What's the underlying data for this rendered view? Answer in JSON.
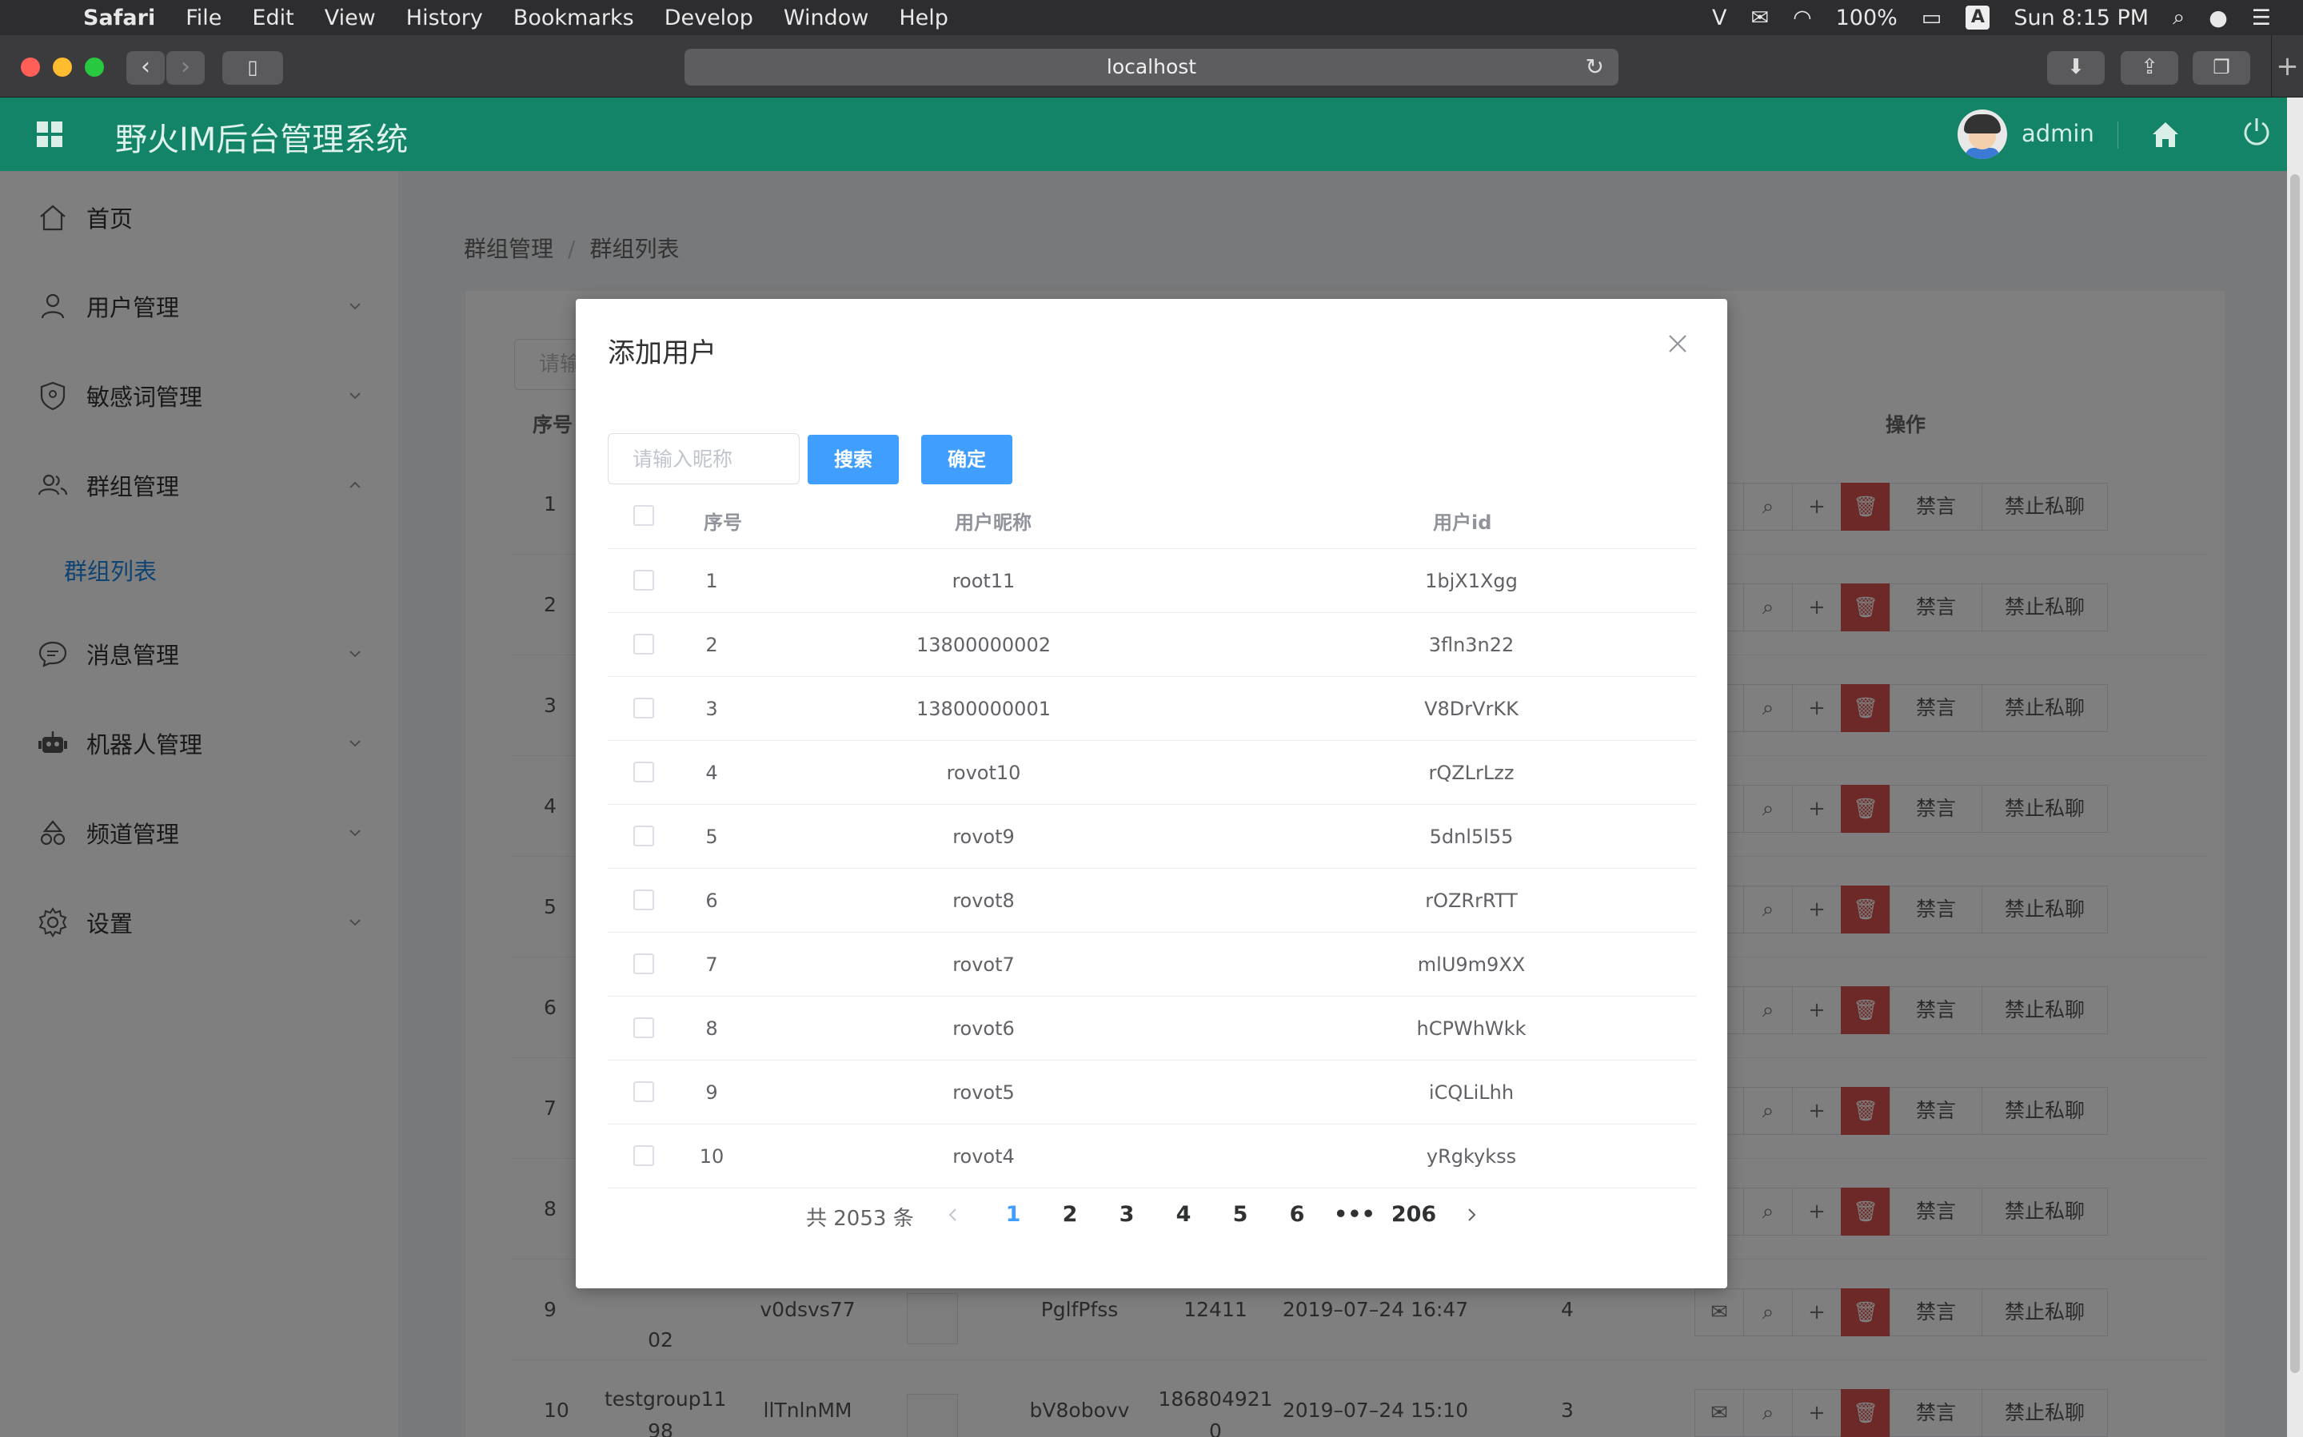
{
  "menubar": {
    "items": [
      "Safari",
      "File",
      "Edit",
      "View",
      "History",
      "Bookmarks",
      "Develop",
      "Window",
      "Help"
    ],
    "battery": "100%",
    "input_source": "A",
    "clock": "Sun 8:15 PM"
  },
  "browser": {
    "url": "localhost"
  },
  "app": {
    "title": "野火IM后台管理系统",
    "user": "admin"
  },
  "sidebar": {
    "items": [
      {
        "label": "首页",
        "icon": "home-icon"
      },
      {
        "label": "用户管理",
        "icon": "user-icon"
      },
      {
        "label": "敏感词管理",
        "icon": "shield-icon"
      },
      {
        "label": "群组管理",
        "icon": "group-icon"
      },
      {
        "label": "消息管理",
        "icon": "message-icon"
      },
      {
        "label": "机器人管理",
        "icon": "robot-icon"
      },
      {
        "label": "频道管理",
        "icon": "channel-icon"
      },
      {
        "label": "设置",
        "icon": "gear-icon"
      }
    ],
    "sub_item": "群组列表"
  },
  "breadcrumb": {
    "parent": "群组管理",
    "sep": "/",
    "current": "群组列表"
  },
  "background_table": {
    "filter_placeholder": "请输",
    "col_index": "序号",
    "col_actions": "操作",
    "btn_mute": "禁言",
    "btn_no_private": "禁止私聊",
    "rows": [
      {
        "idx": "1"
      },
      {
        "idx": "2"
      },
      {
        "idx": "3"
      },
      {
        "idx": "4"
      },
      {
        "idx": "5"
      },
      {
        "idx": "6"
      },
      {
        "idx": "7"
      },
      {
        "idx": "8"
      },
      {
        "idx": "9",
        "name_line2": "02",
        "owner": "v0dsvs77",
        "gid": "PglfPfss",
        "num": "12411",
        "time": "2019–07–24 16:47",
        "count": "4"
      },
      {
        "idx": "10",
        "name_line1": "testgroup11",
        "name_line2": "98",
        "owner": "llTnlnMM",
        "gid": "bV8obovv",
        "num": "186804921",
        "num_line2": "0",
        "time": "2019–07–24 15:10",
        "count": "3"
      }
    ]
  },
  "dialog": {
    "title": "添加用户",
    "search_placeholder": "请输入昵称",
    "search_button": "搜索",
    "confirm_button": "确定",
    "columns": {
      "index": "序号",
      "nickname": "用户昵称",
      "uid": "用户id"
    },
    "rows": [
      {
        "idx": "1",
        "nickname": "root11",
        "uid": "1bjX1Xgg"
      },
      {
        "idx": "2",
        "nickname": "13800000002",
        "uid": "3fln3n22"
      },
      {
        "idx": "3",
        "nickname": "13800000001",
        "uid": "V8DrVrKK"
      },
      {
        "idx": "4",
        "nickname": "rovot10",
        "uid": "rQZLrLzz"
      },
      {
        "idx": "5",
        "nickname": "rovot9",
        "uid": "5dnl5l55"
      },
      {
        "idx": "6",
        "nickname": "rovot8",
        "uid": "rOZRrRTT"
      },
      {
        "idx": "7",
        "nickname": "rovot7",
        "uid": "mlU9m9XX"
      },
      {
        "idx": "8",
        "nickname": "rovot6",
        "uid": "hCPWhWkk"
      },
      {
        "idx": "9",
        "nickname": "rovot5",
        "uid": "iCQLiLhh"
      },
      {
        "idx": "10",
        "nickname": "rovot4",
        "uid": "yRgkykss"
      }
    ],
    "pagination": {
      "total": "共 2053 条",
      "pages": [
        "1",
        "2",
        "3",
        "4",
        "5",
        "6"
      ],
      "ellipsis": "•••",
      "last": "206",
      "current": "1"
    }
  },
  "colors": {
    "header": "#138468",
    "primary": "#409eff",
    "danger": "#d9534f",
    "active_link": "#1e88e5"
  }
}
